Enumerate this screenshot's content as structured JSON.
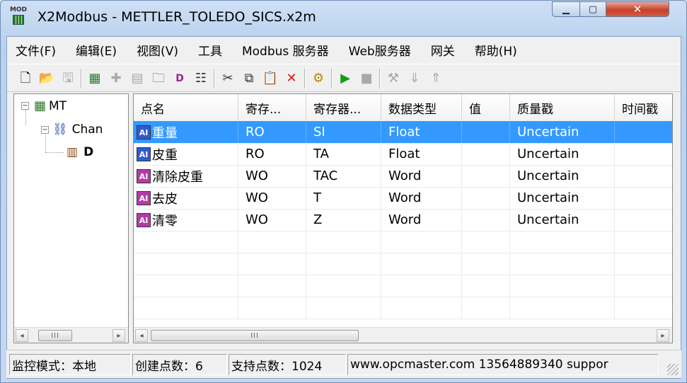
{
  "window": {
    "title": "X2Modbus - METTLER_TOLEDO_SICS.x2m",
    "icon_label": "MOD"
  },
  "menu": [
    {
      "label": "文件(F)"
    },
    {
      "label": "编辑(E)"
    },
    {
      "label": "视图(V)"
    },
    {
      "label": "工具"
    },
    {
      "label": "Modbus 服务器"
    },
    {
      "label": "Web服务器"
    },
    {
      "label": "网关"
    },
    {
      "label": "帮助(H)"
    }
  ],
  "toolbar": {
    "icons": [
      "new-file-icon",
      "open-folder-icon",
      "save-icon",
      "device-icon",
      "add-tag-icon",
      "tag-list-icon",
      "add-folder-icon",
      "data-block-icon",
      "properties-icon",
      "cut-icon",
      "copy-icon",
      "paste-icon",
      "delete-icon",
      "monitor-icon",
      "run-icon",
      "stop-icon",
      "tools-icon",
      "load-icon",
      "upload-icon"
    ]
  },
  "tree": {
    "root": {
      "label": "MT",
      "expander": "−"
    },
    "channel": {
      "label": "Chan",
      "expander": "−"
    },
    "device": {
      "label": "D"
    }
  },
  "table": {
    "columns": [
      {
        "label": "点名"
      },
      {
        "label": "寄存..."
      },
      {
        "label": "寄存器..."
      },
      {
        "label": "数据类型"
      },
      {
        "label": "值"
      },
      {
        "label": "质量戳"
      },
      {
        "label": "时间戳"
      }
    ],
    "rows": [
      {
        "name": "重量",
        "reg_type": "RO",
        "register": "SI",
        "data_type": "Float",
        "value": "",
        "quality": "Uncertain",
        "time": "",
        "icon_color": "#2f5ad6",
        "icon": "AI"
      },
      {
        "name": "皮重",
        "reg_type": "RO",
        "register": "TA",
        "data_type": "Float",
        "value": "",
        "quality": "Uncertain",
        "time": "",
        "icon_color": "#2f5ad6",
        "icon": "AI"
      },
      {
        "name": "清除皮重",
        "reg_type": "WO",
        "register": "TAC",
        "data_type": "Word",
        "value": "",
        "quality": "Uncertain",
        "time": "",
        "icon_color": "#b53aa8",
        "icon": "AI"
      },
      {
        "name": "去皮",
        "reg_type": "WO",
        "register": "T",
        "data_type": "Word",
        "value": "",
        "quality": "Uncertain",
        "time": "",
        "icon_color": "#b53aa8",
        "icon": "AI"
      },
      {
        "name": "清零",
        "reg_type": "WO",
        "register": "Z",
        "data_type": "Word",
        "value": "",
        "quality": "Uncertain",
        "time": "",
        "icon_color": "#b53aa8",
        "icon": "AI"
      }
    ],
    "selected_row": 0
  },
  "scroll": {
    "left_arrow": "◂",
    "right_arrow": "▸",
    "thumb_grip": "III"
  },
  "status": {
    "mode": "监控模式：本地",
    "created": "创建点数：6",
    "supported": "支持点数：1024",
    "contact": "www.opcmaster.com 13564889340 suppor"
  }
}
